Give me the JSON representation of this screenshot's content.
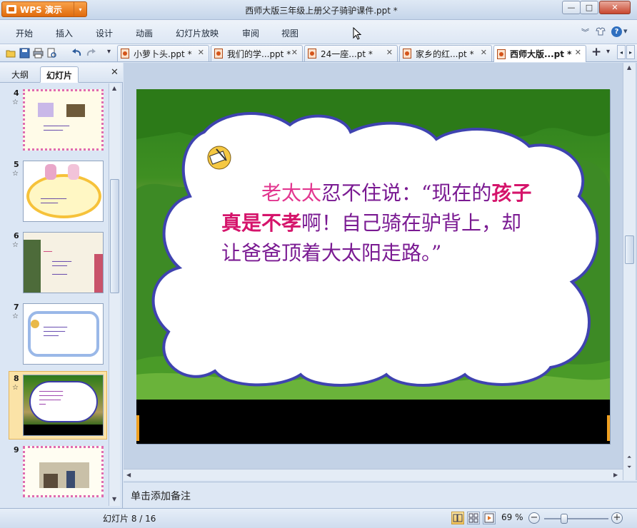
{
  "titlebar": {
    "app_button": "WPS 演示",
    "title": "西师大版三年级上册父子骑驴课件.ppt *",
    "minimize": "—",
    "maximize": "□",
    "close": "✕"
  },
  "menu": {
    "items": [
      "开始",
      "插入",
      "设计",
      "动画",
      "幻灯片放映",
      "审阅",
      "视图"
    ],
    "right_icons": [
      "chevron-down-icon",
      "shirt-icon",
      "help-icon"
    ],
    "help_label": "?"
  },
  "toolbar": {
    "icons": [
      "open-icon",
      "save-icon",
      "print-icon",
      "print-preview-icon",
      "undo-icon",
      "redo-icon",
      "dropdown-icon"
    ]
  },
  "tabs": [
    {
      "label": "小萝卜头.ppt *",
      "close": "✕"
    },
    {
      "label": "我们的学...ppt *",
      "close": "✕"
    },
    {
      "label": "24一座...pt *",
      "close": "✕"
    },
    {
      "label": "家乡的红...pt *",
      "close": "✕"
    },
    {
      "label": "西师大版...pt *",
      "close": "✕",
      "active": true
    }
  ],
  "tab_controls": {
    "add": "+",
    "dropdown": "▾"
  },
  "left_panel": {
    "tabs": [
      "大纲",
      "幻灯片"
    ],
    "active_tab": "幻灯片",
    "close": "✕",
    "thumbnails": [
      {
        "number": "4",
        "star": "☆"
      },
      {
        "number": "5",
        "star": "☆"
      },
      {
        "number": "6",
        "star": "☆"
      },
      {
        "number": "7",
        "star": "☆"
      },
      {
        "number": "8",
        "star": "☆",
        "selected": true
      },
      {
        "number": "9",
        "star": "☆"
      }
    ]
  },
  "slide": {
    "line_parts": [
      {
        "text": "老太太",
        "style": "pink"
      },
      {
        "text": "忍不住说：“现在的",
        "style": "normal"
      },
      {
        "text": "孩子真是不孝",
        "style": "magenta"
      },
      {
        "text": "啊！自己骑在驴背上，却让爸爸顶着大太阳走路。”",
        "style": "normal"
      }
    ]
  },
  "notes": {
    "placeholder": "单击添加备注"
  },
  "status": {
    "slide_counter": "幻灯片 8 / 16",
    "zoom": "69 %",
    "zoom_out": "−",
    "zoom_in": "+"
  }
}
